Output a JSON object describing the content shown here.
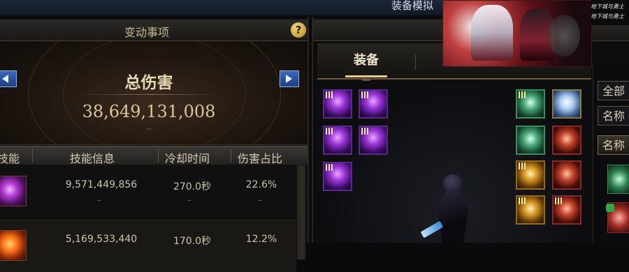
{
  "top_bar": {
    "title": "装备模拟"
  },
  "damage_panel": {
    "header_title": "变动事项",
    "help_icon": "question-mark-icon",
    "total_label": "总伤害",
    "total_value": "38,649,131,008",
    "total_dash": "–"
  },
  "skill_table": {
    "columns": [
      "技能",
      "技能信息",
      "冷却时间",
      "伤害占比"
    ],
    "rows": [
      {
        "icon": "purple-claw-skill-icon",
        "damage": "9,571,449,856",
        "cooldown": "270.0秒",
        "percent": "22.6%",
        "dash": "–"
      },
      {
        "icon": "fire-skill-icon",
        "damage": "5,169,533,440",
        "cooldown": "170.0秒",
        "percent": "12.2%",
        "dash": "–"
      }
    ]
  },
  "equipment_panel": {
    "tabs": [
      {
        "label": "装备",
        "active": true
      }
    ]
  },
  "side_filters": {
    "all_label": "全部",
    "name_label": "名称",
    "name_button": "名称"
  },
  "promo": {
    "logo_line1": "地下城与勇士",
    "logo_line2": "地下城与勇士"
  },
  "colors": {
    "accent_gold": "#e7c98a",
    "blue_arrow": "#3a66b8",
    "epic_purple": "#9a34d6"
  }
}
